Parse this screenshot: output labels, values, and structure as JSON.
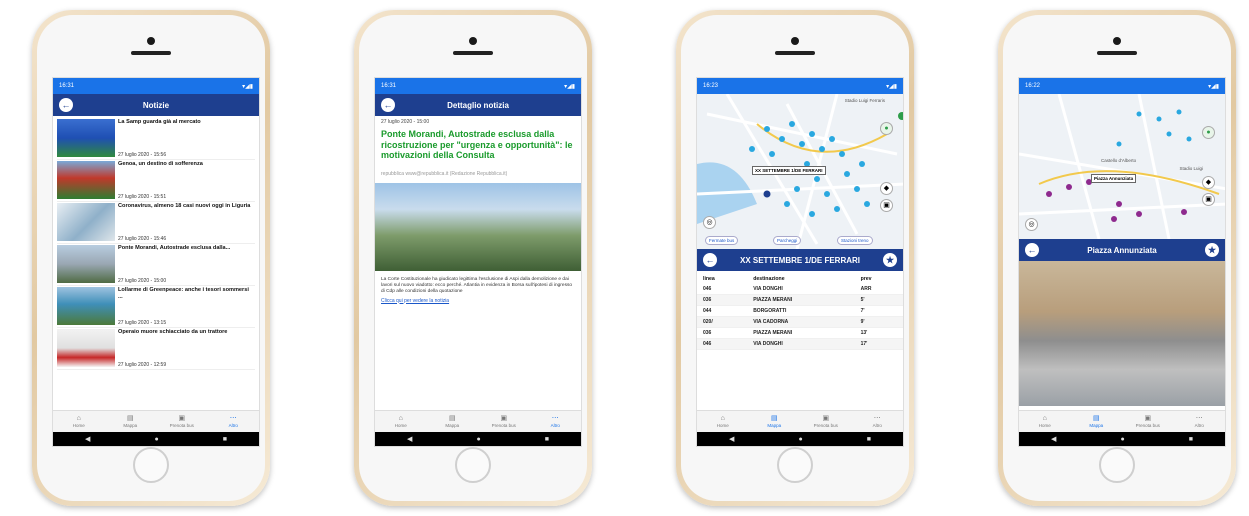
{
  "status_time": [
    "16:31",
    "16:31",
    "16:23",
    "16:22"
  ],
  "status_icons": "▾◢▮",
  "tabs": [
    {
      "label": "Home",
      "icon": "⌂"
    },
    {
      "label": "Mappa",
      "icon": "▤"
    },
    {
      "label": "Prenota bus",
      "icon": "▣"
    },
    {
      "label": "Altro",
      "icon": "⋯"
    }
  ],
  "nav_buttons": [
    "◀",
    "●",
    "■"
  ],
  "phone1": {
    "title": "Notizie",
    "news": [
      {
        "title": "La Samp guarda già al mercato",
        "date": "27 luglio 2020 - 15:56"
      },
      {
        "title": "Genoa, un destino di sofferenza",
        "date": "27 luglio 2020 - 15:51"
      },
      {
        "title": "Coronavirus, almeno 18 casi nuovi oggi in Liguria",
        "date": "27 luglio 2020 - 15:46"
      },
      {
        "title": "Ponte Morandi, Autostrade esclusa dalla...",
        "date": "27 luglio 2020 - 15:00"
      },
      {
        "title": "Lollarme di Greenpeace: anche i tesori sommersi ...",
        "date": "27 luglio 2020 - 13:15"
      },
      {
        "title": "Operaio muore schiacciato da un trattore",
        "date": "27 luglio 2020 - 12:59"
      }
    ]
  },
  "phone2": {
    "title": "Dettaglio notizia",
    "date": "27 luglio 2020 - 15:00",
    "headline": "Ponte Morandi, Autostrade esclusa dalla ricostruzione per \"urgenza e opportunità\": le motivazioni della Consulta",
    "source": "repubblica www@repubblica.it (Redazione Repubblica.it)",
    "body": "La Corte Costituzionale ha giudicato legittima l'esclusione di Aspi dalla demolizione e dai lavori sul nuovo viadotto: ecco perché. Atlantia in evidenza in Borsa sull'ipotesi di ingresso di Cdp alle condizioni della quotazione",
    "link": "Clicca qui per vedere la notizia"
  },
  "phone3": {
    "map_label": "XX SETTEMBRE 1/DE FERRARI",
    "map_corner": "Stadio Luigi Ferraris",
    "chips": [
      "Fermate bus",
      "Parcheggi",
      "Stazioni treno"
    ],
    "stop_title": "XX SETTEMBRE 1/DE FERRARI",
    "columns": [
      "linea",
      "destinazione",
      "prev"
    ],
    "rows": [
      [
        "046",
        "VIA DONGHI",
        "ARR"
      ],
      [
        "036",
        "PIAZZA MERANI",
        "5'"
      ],
      [
        "044",
        "BORGORATTI",
        "7'"
      ],
      [
        "020/",
        "VIA CADORNA",
        "9'"
      ],
      [
        "036",
        "PIAZZA MERANI",
        "13'"
      ],
      [
        "046",
        "VIA DONGHI",
        "17'"
      ]
    ]
  },
  "phone4": {
    "map_label": "Piazza Annunziata",
    "map_places": [
      "Castello d'Alberto",
      "Stadio Luigi"
    ],
    "title": "Piazza Annunziata"
  },
  "colors": {
    "statusbar": "#1a73e8",
    "appbar": "#1e3f8f",
    "headline_green": "#1a9b2c",
    "link_blue": "#1a57c9",
    "phone_gold": "#e2c9a2"
  }
}
